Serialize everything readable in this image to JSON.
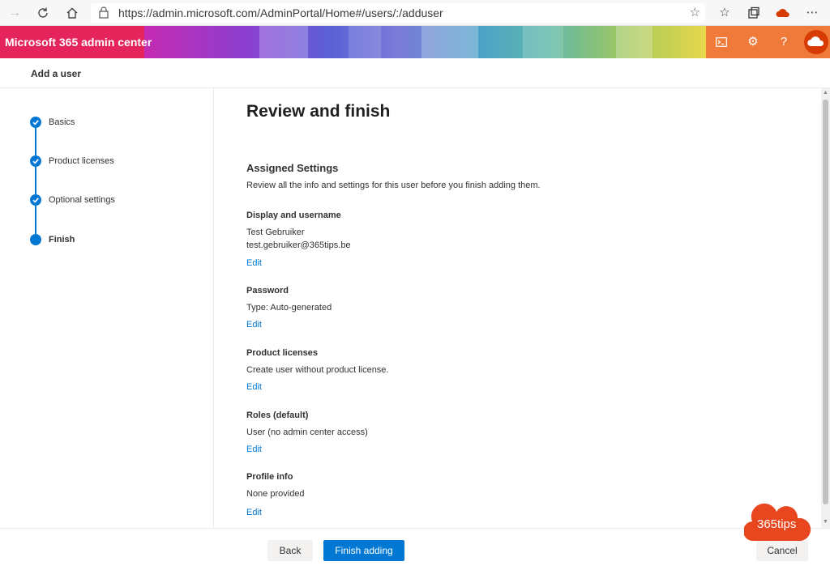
{
  "browser": {
    "url": "https://admin.microsoft.com/AdminPortal/Home#/users/:/adduser"
  },
  "header": {
    "app_title": "Microsoft 365 admin center"
  },
  "subheader": {
    "title": "Add a user"
  },
  "stepper": {
    "steps": [
      {
        "label": "Basics",
        "state": "completed"
      },
      {
        "label": "Product licenses",
        "state": "completed"
      },
      {
        "label": "Optional settings",
        "state": "completed"
      },
      {
        "label": "Finish",
        "state": "current"
      }
    ]
  },
  "main": {
    "title": "Review and finish",
    "section_title": "Assigned Settings",
    "section_description": "Review all the info and settings for this user before you finish adding them.",
    "groups": [
      {
        "title": "Display and username",
        "lines": [
          "Test Gebruiker",
          "test.gebruiker@365tips.be"
        ],
        "edit_label": "Edit"
      },
      {
        "title": "Password",
        "lines": [
          "Type: Auto-generated"
        ],
        "edit_label": "Edit"
      },
      {
        "title": "Product licenses",
        "lines": [
          "Create user without product license."
        ],
        "edit_label": "Edit"
      },
      {
        "title": "Roles (default)",
        "lines": [
          "User (no admin center access)"
        ],
        "edit_label": "Edit"
      },
      {
        "title": "Profile info",
        "lines": [
          "None provided"
        ],
        "edit_label": "Edit"
      }
    ]
  },
  "footer": {
    "back_label": "Back",
    "finish_label": "Finish adding",
    "cancel_label": "Cancel"
  },
  "watermark": {
    "text": "365tips"
  },
  "colors": {
    "accent": "#0078d4",
    "brand_pink": "#e5245b",
    "header_right": "#f07a3a",
    "watermark": "#e8461e"
  },
  "icons": [
    "back-arrow-icon",
    "refresh-icon",
    "home-icon",
    "lock-icon",
    "favorite-star-icon",
    "favorites-icon",
    "collections-icon",
    "cloud-icon",
    "more-icon",
    "terminal-icon",
    "gear-icon",
    "help-icon",
    "checkmark-icon"
  ]
}
